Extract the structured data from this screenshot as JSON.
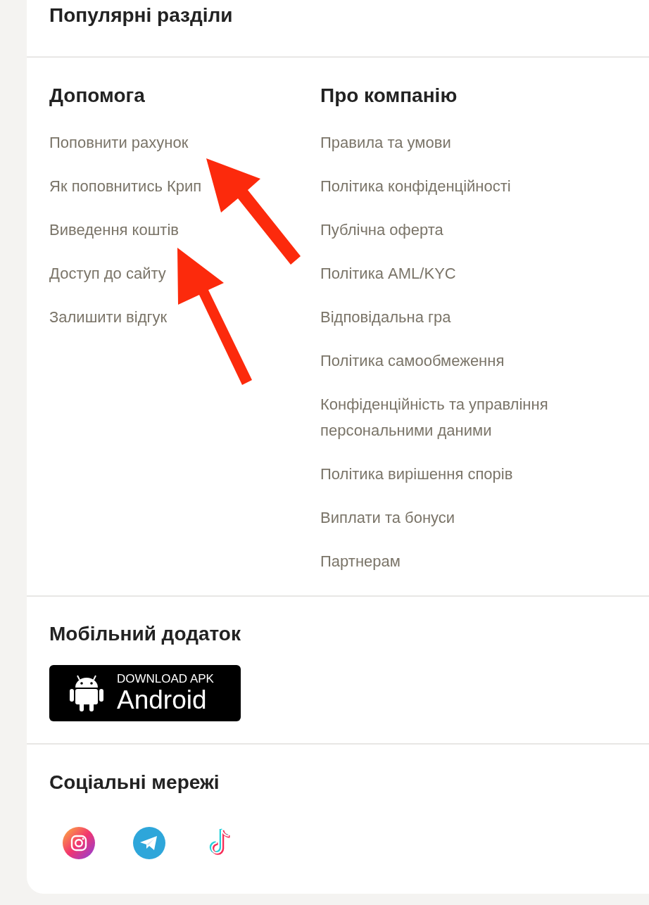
{
  "popular_sections": {
    "title": "Популярні разділи"
  },
  "help": {
    "title": "Допомога",
    "links": [
      "Поповнити рахунок",
      "Як поповнитись Крип",
      "Виведення коштів",
      "Доступ до сайту",
      "Залишити відгук"
    ]
  },
  "company": {
    "title": "Про компанію",
    "links": [
      "Правила та умови",
      "Політика конфіденційності",
      "Публічна оферта",
      "Політика AML/KYC",
      "Відповідальна гра",
      "Політика самообмеження",
      "Конфіденційність та управління персональними даними",
      "Політика вирішення спорів",
      "Виплати та бонуси",
      "Партнерам"
    ]
  },
  "mobile_app": {
    "title": "Мобільний додаток",
    "button": {
      "caption": "DOWNLOAD APK",
      "label": "Android"
    }
  },
  "social": {
    "title": "Соціальні мережі"
  }
}
